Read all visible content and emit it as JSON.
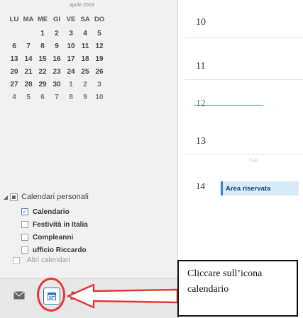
{
  "mini_calendar": {
    "month_label": "aprile 2019",
    "weekdays": [
      "LU",
      "MA",
      "ME",
      "GI",
      "VE",
      "SA",
      "DO"
    ],
    "weeks": [
      [
        "",
        "",
        "1",
        "2",
        "3",
        "4",
        "5"
      ],
      [
        "6",
        "7",
        "8",
        "9",
        "10",
        "11",
        "12"
      ],
      [
        "13",
        "14",
        "15",
        "16",
        "17",
        "18",
        "19"
      ],
      [
        "20",
        "21",
        "22",
        "23",
        "24",
        "25",
        "26"
      ],
      [
        "27",
        "28",
        "29",
        "30",
        "1",
        "2",
        "3"
      ],
      [
        "4",
        "5",
        "6",
        "7",
        "8",
        "9",
        "10"
      ]
    ]
  },
  "calendar_group": {
    "label": "Calendari personali",
    "items": [
      {
        "label": "Calendario",
        "checked": true
      },
      {
        "label": "Festività in Italia",
        "checked": false
      },
      {
        "label": "Compleanni",
        "checked": false
      },
      {
        "label": "ufficio Riccardo",
        "checked": false
      }
    ],
    "ghost_label": "Altri calendari"
  },
  "nav_icons": [
    "mail-icon",
    "calendar-icon",
    "people-icon",
    "tasks-icon",
    "more-icon"
  ],
  "day_view": {
    "hours": [
      "10",
      "11",
      "12",
      "13",
      "14"
    ],
    "event_label": "Area riservata",
    "ghost_text": "Cat"
  },
  "callout": {
    "line1": "Cliccare sull’icona",
    "line2": "calendario"
  },
  "colors": {
    "accent": "#2e6bc4",
    "highlight_ring": "#e53935",
    "event_bg": "#d7ebf7"
  }
}
